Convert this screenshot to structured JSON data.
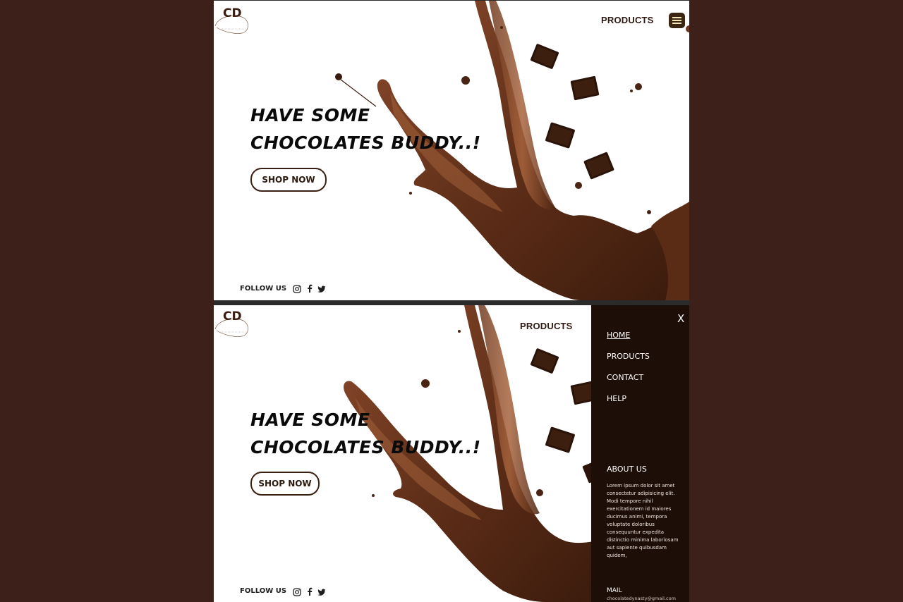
{
  "brand": {
    "logo_text": "CD"
  },
  "nav": {
    "products_label": "PRODUCTS"
  },
  "hero": {
    "title": "HAVE  SOME  CHOCOLATES BUDDY..!",
    "shop_button": "SHOP NOW"
  },
  "social": {
    "follow_label": "FOLLOW US",
    "icons": [
      "instagram-icon",
      "facebook-icon",
      "twitter-icon"
    ]
  },
  "drawer": {
    "close_label": "X",
    "items": [
      {
        "label": "HOME",
        "active": true
      },
      {
        "label": "PRODUCTS",
        "active": false
      },
      {
        "label": "CONTACT",
        "active": false
      },
      {
        "label": "HELP",
        "active": false
      }
    ],
    "about_heading": "ABOUT US",
    "about_text": "Lorem ipsum dolor sit amet consectetur adipisicing elit. Modi tempore nihil exercitationem id maiores ducimus animi, tempora voluptate doloribus consequuntur expedita distinctio minima laboriosam aut sapiente quibusdam quidem,",
    "mail_heading": "MAIL",
    "mail_value": "chocolatedynasty@gmail.com"
  },
  "colors": {
    "page_background": "#3d201a",
    "chocolate_dark": "#3a1c10",
    "chocolate_mid": "#6b3a22",
    "drawer_background": "#1d0e08",
    "menu_button": "#3a2612"
  }
}
